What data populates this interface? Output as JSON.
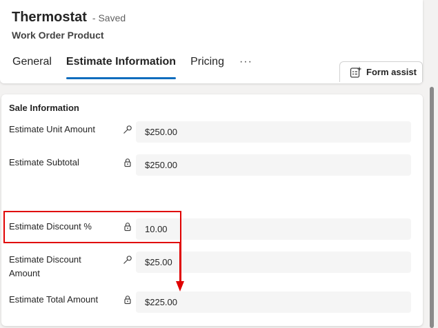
{
  "header": {
    "title": "Thermostat",
    "saved_status": "- Saved",
    "entity_type": "Work Order Product"
  },
  "tabs": [
    {
      "label": "General",
      "active": false
    },
    {
      "label": "Estimate Information",
      "active": true
    },
    {
      "label": "Pricing",
      "active": false
    }
  ],
  "tabs_more_label": "···",
  "form_assist": {
    "label": "Form assist",
    "icon": "form-assist-sparkle-icon"
  },
  "section": {
    "title": "Sale Information",
    "fields": [
      {
        "label": "Estimate Unit Amount",
        "icon": "key-icon",
        "value": "$250.00"
      },
      {
        "label": "Estimate Subtotal",
        "icon": "lock-icon",
        "value": "$250.00"
      },
      {
        "label": "Estimate Discount %",
        "icon": "lock-icon",
        "value": "10.00"
      },
      {
        "label": "Estimate Discount Amount",
        "icon": "key-icon",
        "value": "$25.00"
      },
      {
        "label": "Estimate Total Amount",
        "icon": "lock-icon",
        "value": "$225.00"
      }
    ]
  },
  "colors": {
    "accent": "#0f6cbd",
    "annotation": "#e00000",
    "input_bg": "#f5f5f5"
  }
}
